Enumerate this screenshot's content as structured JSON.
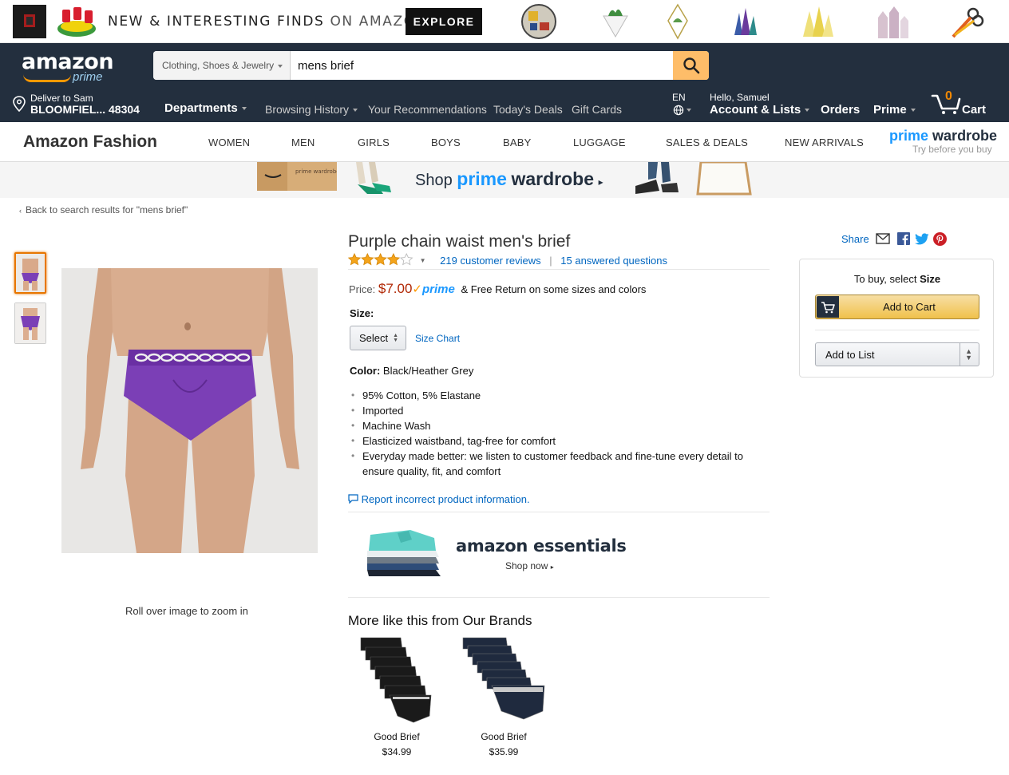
{
  "promo": {
    "text_bold": "NEW & INTERESTING FINDS",
    "text_light": "ON AMAZON",
    "button": "EXPLORE"
  },
  "nav": {
    "logo_word": "amazon",
    "logo_prime": "prime",
    "search_category": "Clothing, Shoes & Jewelry",
    "search_value": "mens brief",
    "deliver_line1": "Deliver to Sam",
    "deliver_line2": "BLOOMFIEL... 48304",
    "departments": "Departments",
    "links": [
      "Browsing History",
      "Your Recommendations",
      "Today's Deals",
      "Gift Cards"
    ],
    "lang": "EN",
    "hello": "Hello, Samuel",
    "account": "Account & Lists",
    "orders": "Orders",
    "prime": "Prime",
    "cart_count": "0",
    "cart": "Cart"
  },
  "fashion": {
    "title": "Amazon Fashion",
    "items": [
      "WOMEN",
      "MEN",
      "GIRLS",
      "BOYS",
      "BABY",
      "LUGGAGE",
      "SALES & DEALS",
      "NEW ARRIVALS"
    ],
    "pw_prime": "prime",
    "pw_wardrobe": "wardrobe",
    "pw_sub": "Try before you buy"
  },
  "banner": {
    "shop": "Shop",
    "prime": "prime",
    "wardrobe": "wardrobe",
    "box_label": "prime wardrobe"
  },
  "breadcrumb": "Back to search results for \"mens brief\"",
  "image": {
    "zoom_hint": "Roll over image to zoom in"
  },
  "product": {
    "title": "Purple chain waist men's brief",
    "stars": 4,
    "reviews": "219 customer reviews",
    "questions": "15 answered questions",
    "price_label": "Price:",
    "price": "$7.00",
    "prime_badge": "prime",
    "free_return": "& Free Return on some sizes and colors",
    "size_label": "Size:",
    "size_select": "Select",
    "size_chart": "Size Chart",
    "color_label": "Color:",
    "color_value": "Black/Heather Grey",
    "bullets": [
      "95% Cotton, 5% Elastane",
      "Imported",
      "Machine Wash",
      "Elasticized waistband, tag-free for comfort",
      "Everyday made better: we listen to customer feedback and fine-tune every detail to ensure quality, fit, and comfort"
    ],
    "report": "Report incorrect product information."
  },
  "essentials": {
    "title": "amazon essentials",
    "shop_now": "Shop now"
  },
  "more": {
    "title": "More like this from Our Brands",
    "items": [
      {
        "name": "Good Brief",
        "price": "$34.99"
      },
      {
        "name": "Good Brief",
        "price": "$35.99"
      }
    ]
  },
  "buybox": {
    "share": "Share",
    "hint_prefix": "To buy, select",
    "hint_bold": "Size",
    "add_to_cart": "Add to Cart",
    "add_to_list": "Add to List"
  },
  "colors": {
    "nav_bg": "#232f3e",
    "search_btn": "#febd69",
    "price": "#b12704",
    "link": "#0066c0",
    "prime_blue": "#1a98ff",
    "product_purple": "#7b3fb6"
  }
}
